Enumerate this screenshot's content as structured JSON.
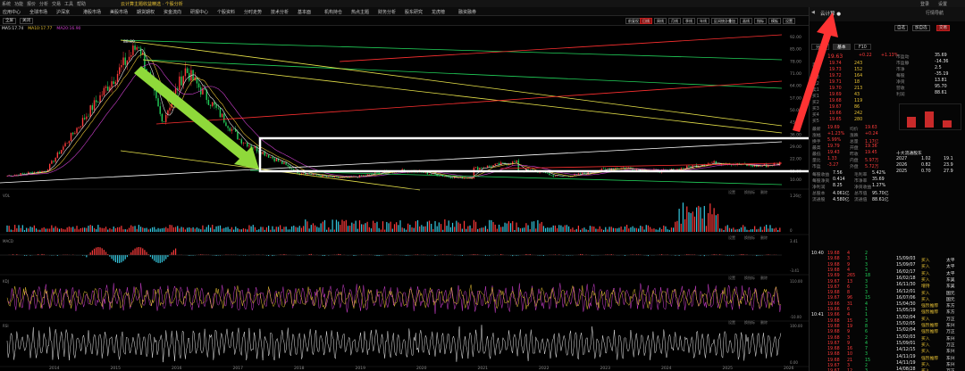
{
  "menubar": {
    "items": [
      "系统",
      "功能",
      "报价",
      "分析",
      "交易",
      "工具",
      "帮助"
    ],
    "title": "云计算主题收益精选 · 个股分析",
    "right": [
      "登录",
      "设置"
    ]
  },
  "nav": {
    "items": [
      "应用中心",
      "全球市场",
      "沪深京",
      "港股市场",
      "美股市场",
      "期货期权",
      "资金流向",
      "研报中心",
      "个股资料",
      "分时走势",
      "技术分析",
      "基本面",
      "机构持仓",
      "热点主题",
      "财务分析",
      "股东研究",
      "龙虎榜",
      "融资融券"
    ],
    "right_tab": "行情导航"
  },
  "toolbar": {
    "buttons": [
      "前复权",
      "日线",
      "周线",
      "月线",
      "季线",
      "年线",
      "区间统计",
      "叠加",
      "画线",
      "指标",
      "模板",
      "设置"
    ],
    "active_index": 1,
    "right": [
      "全屏",
      "关闭"
    ]
  },
  "ma_legend": [
    {
      "label": "MA5:17.74",
      "color": "#e6e6e6"
    },
    {
      "label": "MA10:17.77",
      "color": "#e8c234"
    },
    {
      "label": "MA20:16.90",
      "color": "#d040d0"
    }
  ],
  "price_axis": [
    "92.00",
    "85.00",
    "78.00",
    "71.00",
    "64.00",
    "57.00",
    "50.00",
    "43.00",
    "36.00",
    "29.00",
    "22.00",
    "15.00",
    "10.00"
  ],
  "high_label": "88.89",
  "low_label": "6.11",
  "x_axis": [
    "2014",
    "2015",
    "2016",
    "2017",
    "2018",
    "2019",
    "2020",
    "2021",
    "2022",
    "2023",
    "2024",
    "2025",
    "2026"
  ],
  "panels": {
    "volume": {
      "label": "VOL",
      "scale_top": "1.26亿",
      "scale_bottom": "0"
    },
    "macd": {
      "label": "MACD",
      "scale_top": "3.41",
      "scale_bottom": "-3.41"
    },
    "kdj": {
      "label": "KDJ",
      "scale_top": "110.00",
      "scale_bottom": "-10.00"
    },
    "rsi": {
      "label": "RSI",
      "scale_top": "100.00",
      "scale_bottom": "0.00"
    }
  },
  "panel_tools": [
    "设置",
    "换指标",
    "删除"
  ],
  "side": {
    "stock_name": "云计算 ●",
    "right_tabs": [
      "自选",
      "加自选",
      "交易"
    ],
    "tabs": [
      "分时",
      "基本",
      "F10"
    ],
    "price": "19.63",
    "change": "+0.22",
    "pct": "+1.13%",
    "order_book": [
      {
        "label": "卖5",
        "price": "19.74",
        "vol": "243"
      },
      {
        "label": "卖4",
        "price": "19.73",
        "vol": "152"
      },
      {
        "label": "卖3",
        "price": "19.72",
        "vol": "164"
      },
      {
        "label": "卖2",
        "price": "19.71",
        "vol": "18"
      },
      {
        "label": "卖1",
        "price": "19.70",
        "vol": "213"
      },
      {
        "label": "买1",
        "price": "19.69",
        "vol": "43"
      },
      {
        "label": "买2",
        "price": "19.68",
        "vol": "119"
      },
      {
        "label": "买3",
        "price": "19.67",
        "vol": "86"
      },
      {
        "label": "买4",
        "price": "19.66",
        "vol": "242"
      },
      {
        "label": "买5",
        "price": "19.65",
        "vol": "280"
      }
    ],
    "stats": [
      {
        "k": "最新",
        "v": "19.69",
        "k2": "均价",
        "v2": "19.63"
      },
      {
        "k": "涨幅",
        "v": "+1.23%",
        "k2": "涨跌",
        "v2": "+0.24"
      },
      {
        "k": "换手",
        "v": "5.99%",
        "k2": "总量",
        "v2": "1.17亿"
      },
      {
        "k": "最高",
        "v": "19.79",
        "k2": "开盘",
        "v2": "19.36"
      },
      {
        "k": "最低",
        "v": "19.43",
        "k2": "昨收",
        "v2": "19.45"
      },
      {
        "k": "量比",
        "v": "1.33",
        "k2": "内盘",
        "v2": "5.97万"
      },
      {
        "k": "市盈",
        "v": "-3.27",
        "k2": "外盘",
        "v2": "5.72万"
      }
    ],
    "fundamentals": [
      {
        "k": "每股收益",
        "v": "7.56",
        "k2": "毛利率",
        "v2": "5.42%"
      },
      {
        "k": "每股净资",
        "v": "0.414",
        "k2": "市净率",
        "v2": "35.69"
      },
      {
        "k": "净利润",
        "v": "8.25",
        "k2": "净资收益",
        "v2": "1.27%"
      },
      {
        "k": "总股本",
        "v": "4.061亿",
        "k2": "总市值",
        "v2": "95.70亿"
      },
      {
        "k": "流通股",
        "v": "4.580亿",
        "k2": "流通值",
        "v2": "88.61亿"
      }
    ],
    "right_stats": [
      {
        "k": "市盈动",
        "v": "35.69"
      },
      {
        "k": "市盈静",
        "v": "-14.36"
      },
      {
        "k": "市净",
        "v": "2.5"
      },
      {
        "k": "每股",
        "v": "-35.19"
      },
      {
        "k": "净资",
        "v": "13.81"
      },
      {
        "k": "营收",
        "v": "95.70"
      },
      {
        "k": "利润",
        "v": "88.61"
      }
    ],
    "analyst_header": "十大流通股东",
    "analyst_rows": [
      {
        "y": "2027",
        "a": "1.02",
        "b": "19.1"
      },
      {
        "y": "2026",
        "a": "0.82",
        "b": "23.9"
      },
      {
        "y": "2025",
        "a": "0.70",
        "b": "27.9"
      }
    ],
    "trades_time1": "10:40",
    "trades_time2": "10:41",
    "trades": [
      {
        "p": "19.68",
        "v": "4",
        "n": "2"
      },
      {
        "p": "19.68",
        "v": "3",
        "n": "1"
      },
      {
        "p": "19.68",
        "v": "9",
        "n": "3"
      },
      {
        "p": "19.68",
        "v": "4",
        "n": "3"
      },
      {
        "p": "19.69",
        "v": "265",
        "n": "18"
      },
      {
        "p": "19.67",
        "v": "13",
        "n": "3"
      },
      {
        "p": "19.67",
        "v": "6",
        "n": "3"
      },
      {
        "p": "19.68",
        "v": "8",
        "n": "3"
      },
      {
        "p": "19.67",
        "v": "96",
        "n": "15"
      },
      {
        "p": "19.66",
        "v": "31",
        "n": "4"
      },
      {
        "p": "19.66",
        "v": "6",
        "n": "1"
      },
      {
        "p": "19.66",
        "v": "4",
        "n": "1"
      },
      {
        "p": "19.68",
        "v": "15",
        "n": "3"
      },
      {
        "p": "19.68",
        "v": "19",
        "n": "8"
      },
      {
        "p": "19.68",
        "v": "9",
        "n": "6"
      },
      {
        "p": "19.68",
        "v": "3",
        "n": "2"
      },
      {
        "p": "19.67",
        "v": "9",
        "n": "4"
      },
      {
        "p": "19.68",
        "v": "16",
        "n": "7"
      },
      {
        "p": "19.68",
        "v": "10",
        "n": "3"
      },
      {
        "p": "19.68",
        "v": "21",
        "n": "15"
      },
      {
        "p": "19.67",
        "v": "3",
        "n": "2"
      },
      {
        "p": "19.67",
        "v": "12",
        "n": "3"
      }
    ],
    "ratings": [
      {
        "d": "15/09/03",
        "r": "买入",
        "o": "太平"
      },
      {
        "d": "15/09/07",
        "r": "买入",
        "o": "太平"
      },
      {
        "d": "16/02/17",
        "r": "买入",
        "o": "太平"
      },
      {
        "d": "16/02/18",
        "r": "买入",
        "o": "东吴"
      },
      {
        "d": "16/11/30",
        "r": "增持",
        "o": "东吴"
      },
      {
        "d": "16/12/01",
        "r": "买入",
        "o": "国元"
      },
      {
        "d": "16/07/06",
        "r": "买入",
        "o": "国元"
      },
      {
        "d": "15/04/30",
        "r": "强烈推荐",
        "o": "东方"
      },
      {
        "d": "15/05/19",
        "r": "强烈推荐",
        "o": "东方"
      },
      {
        "d": "15/02/04",
        "r": "买入",
        "o": "万正"
      },
      {
        "d": "15/02/05",
        "r": "强烈推荐",
        "o": "东兴"
      },
      {
        "d": "15/02/04",
        "r": "强烈推荐",
        "o": "万正"
      },
      {
        "d": "15/02/03",
        "r": "买入",
        "o": "东兴"
      },
      {
        "d": "15/09/01",
        "r": "买入",
        "o": "万正"
      },
      {
        "d": "14/12/15",
        "r": "买入",
        "o": "东兴"
      },
      {
        "d": "14/11/19",
        "r": "强烈推荐",
        "o": "东兴"
      },
      {
        "d": "14/11/19",
        "r": "买入",
        "o": "东兴"
      },
      {
        "d": "14/08/28",
        "r": "买入",
        "o": "万正"
      }
    ]
  },
  "colors": {
    "up": "#ff3b3b",
    "down": "#22d15a",
    "ma5": "#e6e6e6",
    "ma10": "#e8c234",
    "ma20": "#d040d0",
    "green_arrow": "#8fd93a",
    "red_arrow": "#ff3333",
    "box": "#ffffff"
  }
}
